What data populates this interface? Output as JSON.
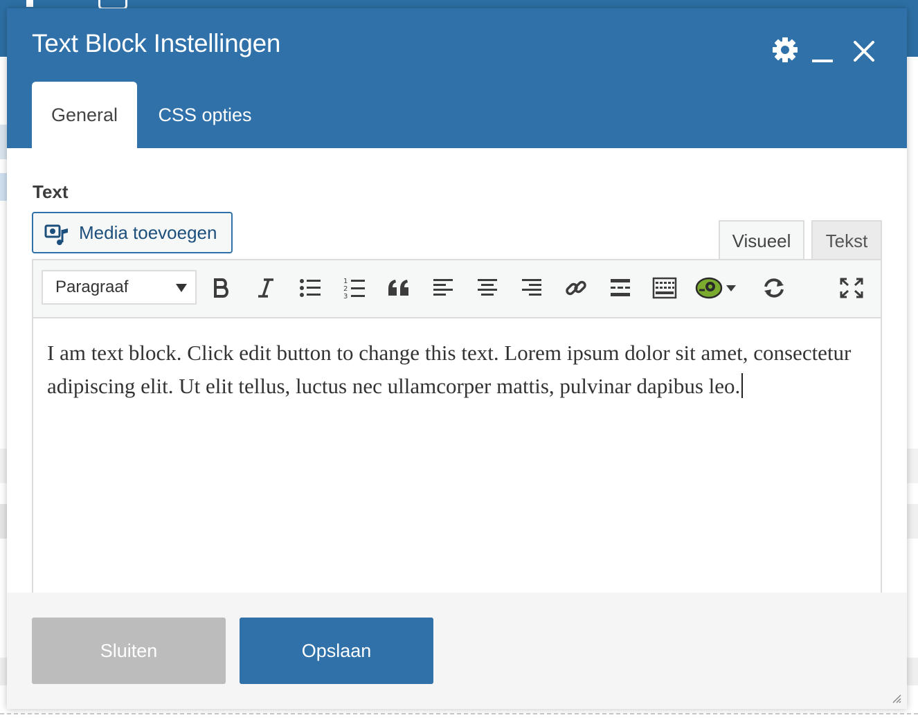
{
  "colors": {
    "header": "#2f71a8",
    "primary_button": "#2f71a8",
    "disabled_button": "#bcbcbc",
    "footer": "#f5f5f5"
  },
  "modal": {
    "title": "Text Block Instellingen",
    "header_icons": [
      "gear-icon",
      "minimize-icon",
      "close-icon"
    ],
    "tabs": [
      {
        "label": "General",
        "active": true
      },
      {
        "label": "CSS opties",
        "active": false
      }
    ]
  },
  "field": {
    "label": "Text",
    "media_button": "Media toevoegen"
  },
  "editor": {
    "modes": [
      {
        "label": "Visueel",
        "active": true
      },
      {
        "label": "Tekst",
        "active": false
      }
    ],
    "format_select": "Paragraaf",
    "toolbar_icons": [
      "bold-icon",
      "italic-icon",
      "bulleted-list-icon",
      "numbered-list-icon",
      "blockquote-icon",
      "align-left-icon",
      "align-center-icon",
      "align-right-icon",
      "link-icon",
      "read-more-icon",
      "toolbar-toggle-icon",
      "plugin-icon",
      "refresh-icon",
      "fullscreen-icon"
    ],
    "content": "I am text block. Click edit button to change this text. Lorem ipsum dolor sit amet, consectetur adipiscing elit. Ut elit tellus, luctus nec ullamcorper mattis, pulvinar dapibus leo."
  },
  "footer": {
    "close_label": "Sluiten",
    "save_label": "Opslaan"
  }
}
